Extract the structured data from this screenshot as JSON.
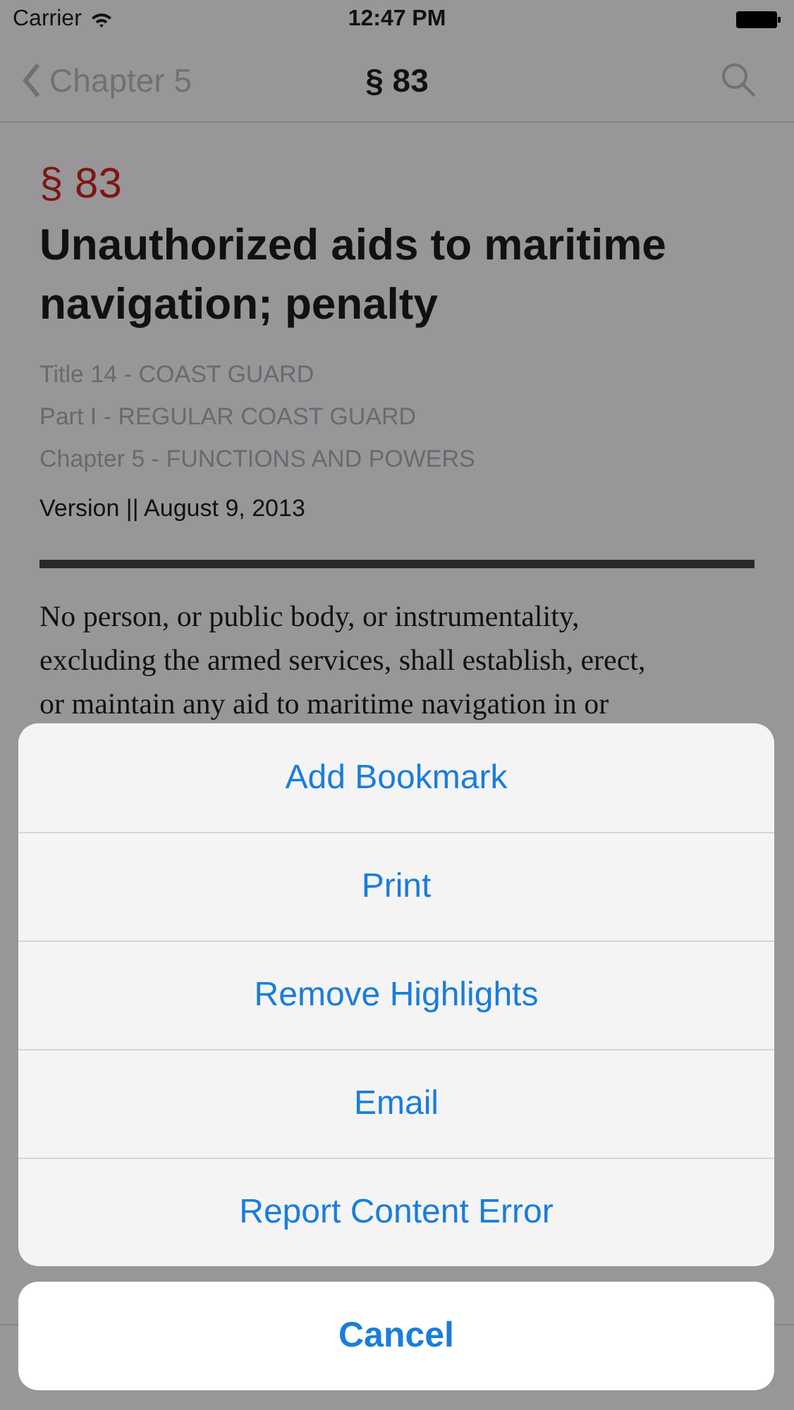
{
  "status_bar": {
    "carrier": "Carrier",
    "time": "12:47 PM"
  },
  "nav_bar": {
    "back_label": "Chapter 5",
    "title": "§ 83"
  },
  "section": {
    "number": "§ 83",
    "title": "Unauthorized aids to maritime navigation; penalty",
    "breadcrumbs": [
      "Title 14 - COAST GUARD",
      "Part I - REGULAR COAST GUARD",
      "Chapter 5 - FUNCTIONS AND POWERS"
    ],
    "version": "Version || August 9, 2013"
  },
  "body_lines": [
    "No person, or public body, or instrumentality,",
    "excluding the armed services, shall establish, erect,",
    "or maintain any aid to maritime navigation in or"
  ],
  "action_sheet": {
    "actions": [
      "Add Bookmark",
      "Print",
      "Remove Highlights",
      "Email",
      "Report Content Error"
    ],
    "cancel": "Cancel"
  }
}
